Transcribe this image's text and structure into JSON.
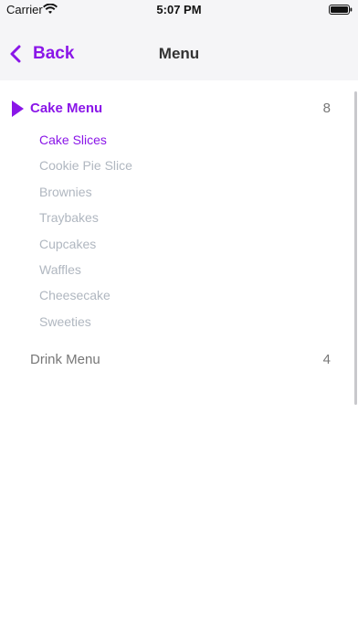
{
  "status_bar": {
    "carrier": "Carrier",
    "time": "5:07 PM"
  },
  "nav": {
    "back_label": "Back",
    "title": "Menu"
  },
  "colors": {
    "accent": "#8a16e8",
    "inactive_text": "#b0b7c0",
    "nav_background": "#f5f5f7"
  },
  "sections": [
    {
      "label": "Cake Menu",
      "count": "8",
      "expanded": true,
      "items": [
        {
          "label": "Cake Slices",
          "selected": true
        },
        {
          "label": "Cookie Pie Slice",
          "selected": false
        },
        {
          "label": "Brownies",
          "selected": false
        },
        {
          "label": "Traybakes",
          "selected": false
        },
        {
          "label": "Cupcakes",
          "selected": false
        },
        {
          "label": "Waffles",
          "selected": false
        },
        {
          "label": "Cheesecake",
          "selected": false
        },
        {
          "label": "Sweeties",
          "selected": false
        }
      ]
    },
    {
      "label": "Drink Menu",
      "count": "4",
      "expanded": false,
      "items": []
    }
  ]
}
